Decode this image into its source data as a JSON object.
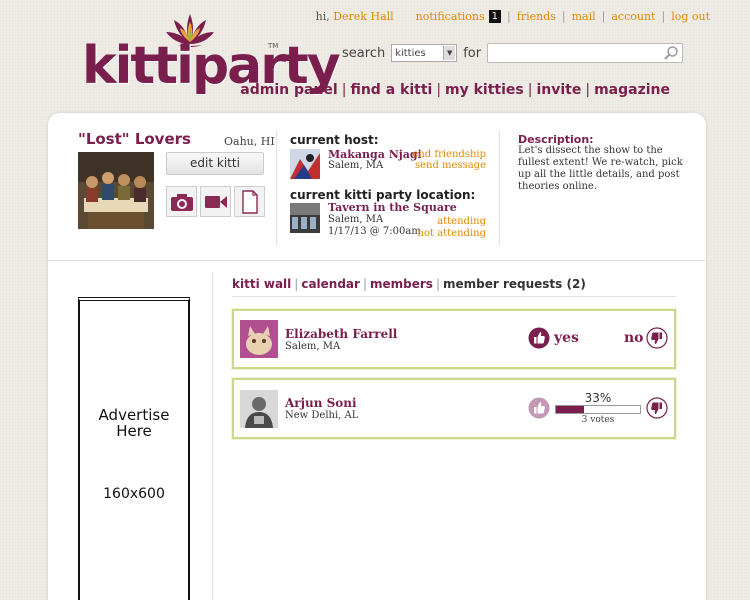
{
  "brand": {
    "logo_text": "kittiparty",
    "tm": "TM"
  },
  "topnav": {
    "greeting": "hi,",
    "user_name": "Derek Hall",
    "notifications_label": "notifications",
    "notifications_count": "1",
    "friends": "friends",
    "mail": "mail",
    "account": "account",
    "logout": "log out"
  },
  "search": {
    "label": "search",
    "category_selected": "kitties",
    "for_label": "for",
    "query": ""
  },
  "mainnav": {
    "items": [
      "admin panel",
      "find a kitti",
      "my kitties",
      "invite",
      "magazine"
    ]
  },
  "kitti": {
    "title": "\"Lost\" Lovers",
    "location": "Oahu, HI",
    "edit_label": "edit kitti"
  },
  "host": {
    "heading": "current host:",
    "name": "Makanga Njagi",
    "location": "Salem, MA",
    "end_friendship": "end friendship",
    "send_message": "send message"
  },
  "party_location": {
    "heading": "current kitti party location:",
    "name": "Tavern in the Square",
    "city": "Salem, MA",
    "datetime": "1/17/13 @ 7:00am",
    "attending": "attending",
    "not_attending": "not attending"
  },
  "description": {
    "label": "Description:",
    "text": "Let's dissect the show to the fullest extent! We re-watch, pick up all the little details, and post theories online."
  },
  "ad": {
    "line1": "Advertise",
    "line2": "Here",
    "size": "160x600"
  },
  "tabs": {
    "items": [
      "kitti wall",
      "calendar",
      "members",
      "member requests (2)"
    ]
  },
  "requests": [
    {
      "name": "Elizabeth Farrell",
      "location": "Salem, MA",
      "yes_label": "yes",
      "no_label": "no"
    },
    {
      "name": "Arjun Soni",
      "location": "New Delhi, AL",
      "percent_label": "33%",
      "percent": 0.33,
      "votes_label": "3 votes"
    }
  ],
  "colors": {
    "brand": "#7a1f4d",
    "link_orange": "#e08a00",
    "request_border": "#c9d98c"
  }
}
